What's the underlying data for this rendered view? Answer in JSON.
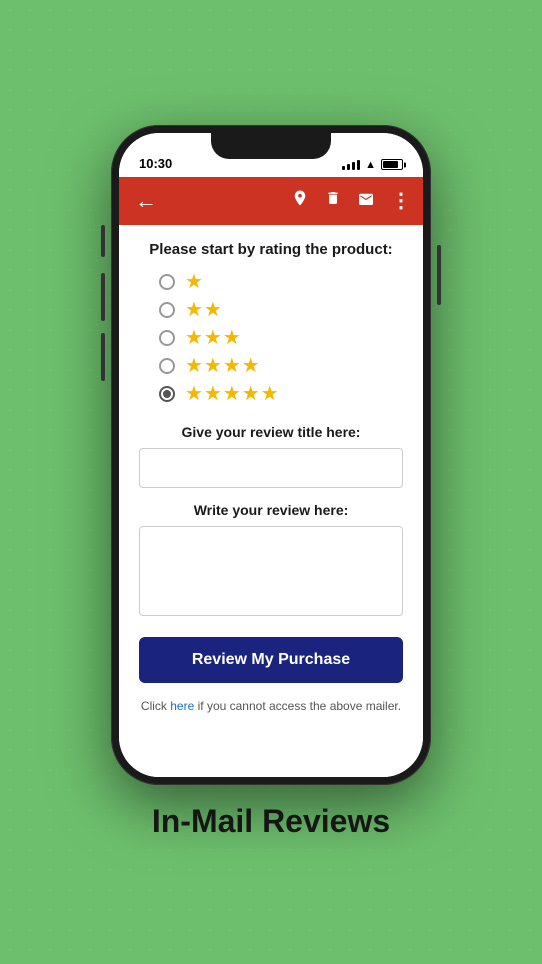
{
  "status_bar": {
    "time": "10:30"
  },
  "app_bar": {
    "back_icon": "←",
    "icons": [
      "⬇",
      "🗑",
      "✉",
      "⋮"
    ]
  },
  "content": {
    "rating_section_title": "Please start by rating the product:",
    "rating_options": [
      {
        "stars": "★",
        "count": 1,
        "selected": false
      },
      {
        "stars": "★★",
        "count": 2,
        "selected": false
      },
      {
        "stars": "★★★",
        "count": 3,
        "selected": false
      },
      {
        "stars": "★★★★",
        "count": 4,
        "selected": false
      },
      {
        "stars": "★★★★★",
        "count": 5,
        "selected": true
      }
    ],
    "title_label": "Give your review title here:",
    "title_placeholder": "",
    "review_label": "Write your review here:",
    "review_placeholder": "",
    "submit_button_label": "Review My Purchase",
    "footer_text_before": "Click ",
    "footer_link_label": "here",
    "footer_text_after": " if you cannot access the above mailer."
  },
  "app_label": "In-Mail Reviews",
  "colors": {
    "app_bar": "#cc3322",
    "submit_button": "#1a237e",
    "star": "#f5b800",
    "link": "#1a6fc4",
    "background": "#6dbf6d"
  }
}
